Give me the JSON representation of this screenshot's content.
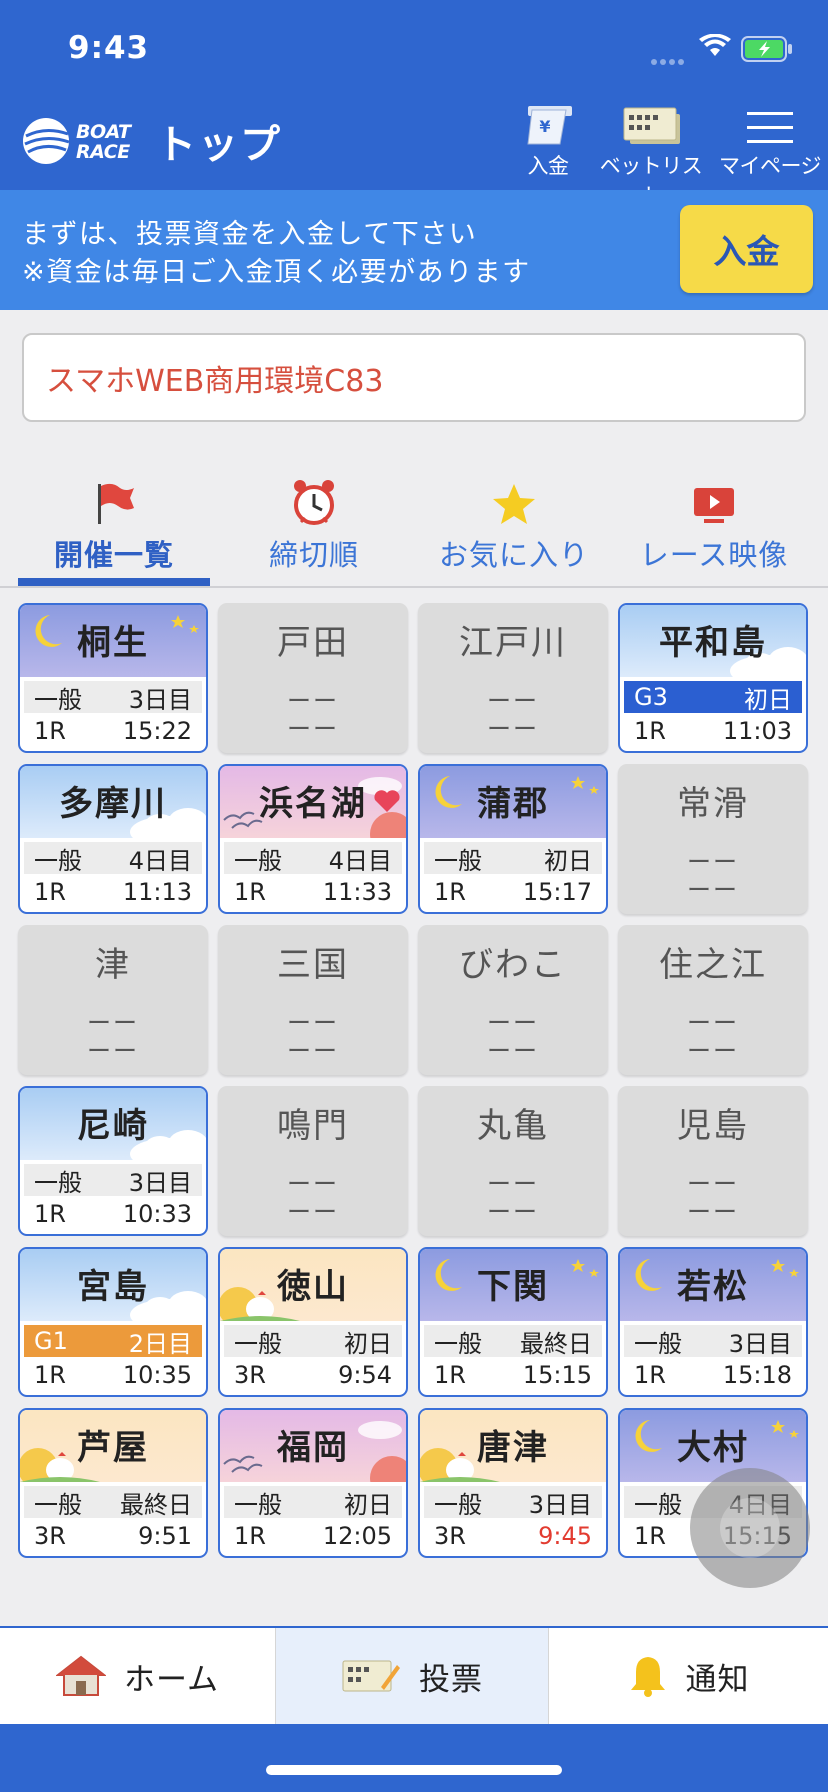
{
  "status_bar": {
    "time": "9:43"
  },
  "header": {
    "logo_text_1": "BOAT",
    "logo_text_2": "RACE",
    "title": "トップ",
    "buttons": [
      {
        "label": "入金",
        "icon": "deposit-icon"
      },
      {
        "label": "ベットリスト",
        "icon": "betlist-icon"
      },
      {
        "label": "マイページ",
        "icon": "menu-icon"
      }
    ]
  },
  "notice": {
    "line1": "まずは、投票資金を入金して下さい",
    "line2": "※資金は毎日ご入金頂く必要があります",
    "button": "入金"
  },
  "environment": "スマホWEB商用環境C83",
  "tabs": [
    {
      "label": "開催一覧",
      "icon": "flag-icon",
      "active": true
    },
    {
      "label": "締切順",
      "icon": "alarm-clock-icon",
      "active": false
    },
    {
      "label": "お気に入り",
      "icon": "star-icon",
      "active": false
    },
    {
      "label": "レース映像",
      "icon": "video-play-icon",
      "active": false
    }
  ],
  "venues": [
    {
      "name": "桐生",
      "active": true,
      "theme": "night",
      "grade": "一般",
      "day": "3日目",
      "race": "1R",
      "time": "15:22"
    },
    {
      "name": "戸田",
      "active": false,
      "dash1": "ーー",
      "dash2": "ーー"
    },
    {
      "name": "江戸川",
      "active": false,
      "dash1": "ーー",
      "dash2": "ーー"
    },
    {
      "name": "平和島",
      "active": true,
      "theme": "day",
      "grade": "G3",
      "grade_style": "g3",
      "day": "初日",
      "race": "1R",
      "time": "11:03"
    },
    {
      "name": "多摩川",
      "active": true,
      "theme": "day",
      "grade": "一般",
      "day": "4日目",
      "race": "1R",
      "time": "11:13"
    },
    {
      "name": "浜名湖",
      "active": true,
      "theme": "dusk",
      "favorite": true,
      "grade": "一般",
      "day": "4日目",
      "race": "1R",
      "time": "11:33"
    },
    {
      "name": "蒲郡",
      "active": true,
      "theme": "night",
      "grade": "一般",
      "day": "初日",
      "race": "1R",
      "time": "15:17"
    },
    {
      "name": "常滑",
      "active": false,
      "dash1": "ーー",
      "dash2": "ーー"
    },
    {
      "name": "津",
      "active": false,
      "dash1": "ーー",
      "dash2": "ーー"
    },
    {
      "name": "三国",
      "active": false,
      "dash1": "ーー",
      "dash2": "ーー"
    },
    {
      "name": "びわこ",
      "active": false,
      "dash1": "ーー",
      "dash2": "ーー"
    },
    {
      "name": "住之江",
      "active": false,
      "dash1": "ーー",
      "dash2": "ーー"
    },
    {
      "name": "尼崎",
      "active": true,
      "theme": "day",
      "grade": "一般",
      "day": "3日目",
      "race": "1R",
      "time": "10:33"
    },
    {
      "name": "鳴門",
      "active": false,
      "dash1": "ーー",
      "dash2": "ーー"
    },
    {
      "name": "丸亀",
      "active": false,
      "dash1": "ーー",
      "dash2": "ーー"
    },
    {
      "name": "児島",
      "active": false,
      "dash1": "ーー",
      "dash2": "ーー"
    },
    {
      "name": "宮島",
      "active": true,
      "theme": "day",
      "grade": "G1",
      "grade_style": "g1",
      "day": "2日目",
      "race": "1R",
      "time": "10:35"
    },
    {
      "name": "徳山",
      "active": true,
      "theme": "morning",
      "grade": "一般",
      "day": "初日",
      "race": "3R",
      "time": "9:54"
    },
    {
      "name": "下関",
      "active": true,
      "theme": "night",
      "grade": "一般",
      "day": "最終日",
      "race": "1R",
      "time": "15:15"
    },
    {
      "name": "若松",
      "active": true,
      "theme": "night",
      "grade": "一般",
      "day": "3日目",
      "race": "1R",
      "time": "15:18"
    },
    {
      "name": "芦屋",
      "active": true,
      "theme": "morning",
      "grade": "一般",
      "day": "最終日",
      "race": "3R",
      "time": "9:51"
    },
    {
      "name": "福岡",
      "active": true,
      "theme": "dusk",
      "grade": "一般",
      "day": "初日",
      "race": "1R",
      "time": "12:05"
    },
    {
      "name": "唐津",
      "active": true,
      "theme": "morning",
      "grade": "一般",
      "day": "3日目",
      "race": "3R",
      "time": "9:45",
      "time_alert": true
    },
    {
      "name": "大村",
      "active": true,
      "theme": "night",
      "grade": "一般",
      "day": "4日目",
      "race": "1R",
      "time": "15:15"
    }
  ],
  "bottom_nav": [
    {
      "label": "ホーム",
      "icon": "home-icon"
    },
    {
      "label": "投票",
      "icon": "ticket-icon"
    },
    {
      "label": "通知",
      "icon": "bell-icon"
    }
  ],
  "colors": {
    "primary": "#2f66cf",
    "notice": "#4087e6",
    "accent_yellow": "#f6da48",
    "alert_red": "#e23b30"
  }
}
